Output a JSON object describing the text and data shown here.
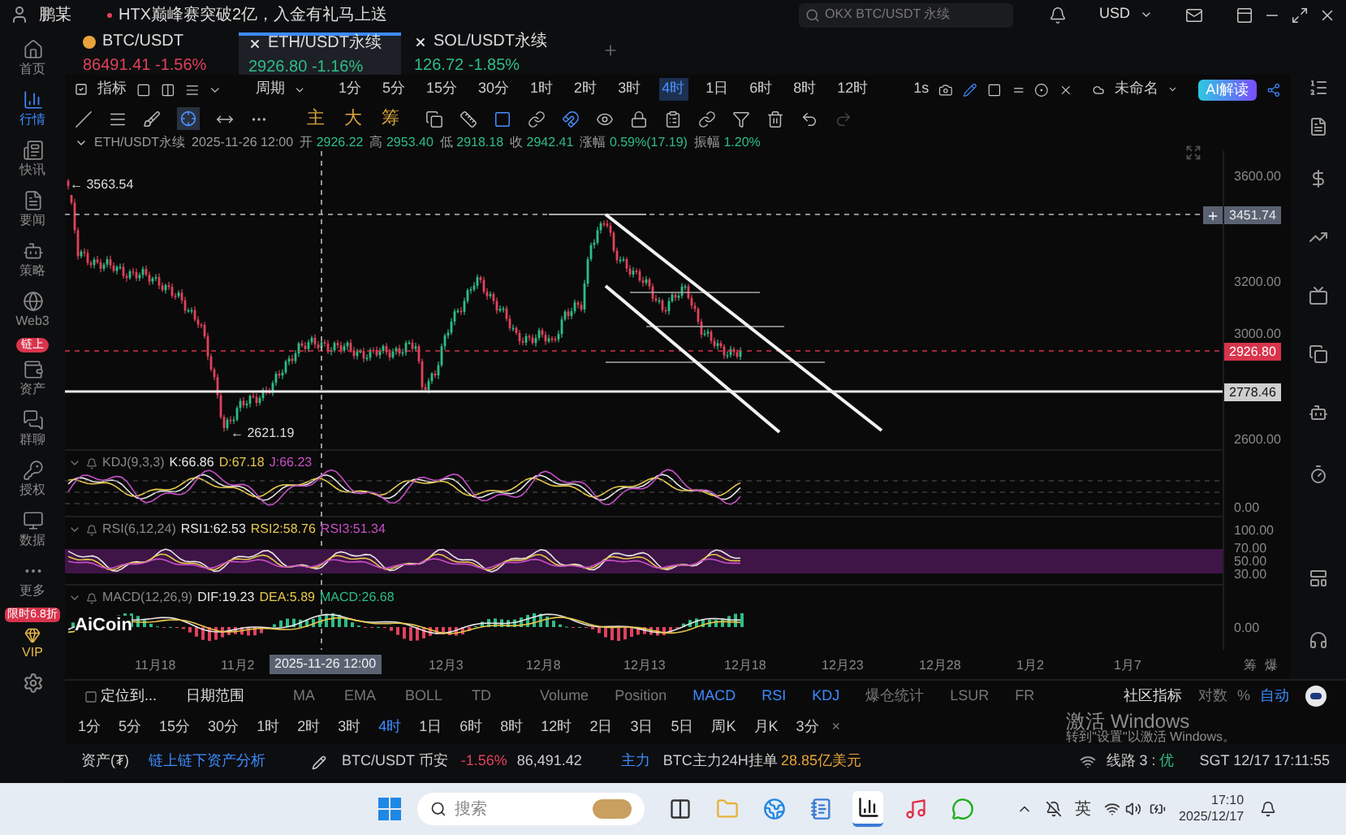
{
  "top_bar": {
    "user": "鹏某",
    "news": "HTX巅峰赛突破2亿，入金有礼马上送",
    "search": {
      "placeholder": "OKX BTC/USDT 永续"
    },
    "currency": "USD"
  },
  "sidebar": {
    "items": [
      {
        "label": "首页",
        "selected": false
      },
      {
        "label": "行情",
        "selected": true
      },
      {
        "label": "快讯",
        "selected": false
      },
      {
        "label": "要闻",
        "selected": false
      },
      {
        "label": "策略",
        "selected": false
      },
      {
        "label": "Web3",
        "selected": false
      },
      {
        "label": "资产",
        "selected": false
      },
      {
        "label": "群聊",
        "selected": false
      },
      {
        "label": "授权",
        "selected": false
      },
      {
        "label": "数据",
        "selected": false
      },
      {
        "label": "更多",
        "selected": false
      }
    ],
    "badge": "链上",
    "promo": "限时6.8折",
    "vip": "VIP"
  },
  "tabs": [
    {
      "symbol": "BTC/USDT",
      "price": "86491.41",
      "change": "-1.56%",
      "color": "#e0425b",
      "selected": false
    },
    {
      "symbol": "ETH/USDT永续",
      "price": "2926.80",
      "change": "-1.16%",
      "color": "#2ebd85",
      "selected": true
    },
    {
      "symbol": "SOL/USDT永续",
      "price": "126.72",
      "change": "-1.85%",
      "color": "#2ebd85",
      "selected": false
    }
  ],
  "toolbar": {
    "indicator": "指标",
    "period": "周期",
    "intervals": [
      {
        "label": "1分",
        "selected": false
      },
      {
        "label": "5分",
        "selected": false
      },
      {
        "label": "15分",
        "selected": false
      },
      {
        "label": "30分",
        "selected": false
      },
      {
        "label": "1时",
        "selected": false
      },
      {
        "label": "2时",
        "selected": false
      },
      {
        "label": "3时",
        "selected": false
      },
      {
        "label": "4时",
        "selected": true
      },
      {
        "label": "1日",
        "selected": false
      },
      {
        "label": "6时",
        "selected": false
      },
      {
        "label": "8时",
        "selected": false
      },
      {
        "label": "12时",
        "selected": false
      }
    ],
    "seconds": "1s",
    "layout": "未命名",
    "ai": "AI解读"
  },
  "drawing_tools": {
    "chips": [
      "主",
      "大",
      "筹"
    ]
  },
  "ohlc": {
    "symbol": "ETH/USDT永续",
    "time": "2025-11-26 12:00",
    "fields": [
      {
        "label": "开",
        "value": "2926.22"
      },
      {
        "label": "高",
        "value": "2953.40"
      },
      {
        "label": "低",
        "value": "2918.18"
      },
      {
        "label": "收",
        "value": "2942.41"
      },
      {
        "label": "涨幅",
        "value": "0.59%(17.19)"
      },
      {
        "label": "振幅",
        "value": "1.20%"
      }
    ]
  },
  "chart": {
    "price_axis": [
      "3600.00",
      "3200.00",
      "3000.00",
      "2600.00"
    ],
    "price_tags": [
      {
        "value": "3451.74",
        "kind": "cursor"
      },
      {
        "value": "2926.80",
        "kind": "last"
      },
      {
        "value": "2778.46",
        "kind": "line"
      }
    ],
    "high_mark": "← 3563.54",
    "low_mark": "← 2621.19",
    "watermark": "AiCoin",
    "dates": [
      "11月18",
      "11月2",
      "12月3",
      "12月8",
      "12月13",
      "12月18",
      "12月23",
      "12月28",
      "1月2",
      "1月7"
    ],
    "crosshair_time": "2025-11-26 12:00",
    "axis_end": [
      "筹",
      "爆"
    ]
  },
  "indicators": [
    {
      "name": "KDJ(9,3,3)",
      "values": [
        {
          "text": "K:66.86",
          "color": "#e6e6e6"
        },
        {
          "text": "D:67.18",
          "color": "#e6c84a"
        },
        {
          "text": "J:66.23",
          "color": "#c84fc8"
        }
      ],
      "axis": [
        "0.00"
      ]
    },
    {
      "name": "RSI(6,12,24)",
      "values": [
        {
          "text": "RSI1:62.53",
          "color": "#e6e6e6"
        },
        {
          "text": "RSI2:58.76",
          "color": "#e6c84a"
        },
        {
          "text": "RSI3:51.34",
          "color": "#c84fc8"
        }
      ],
      "axis": [
        "100.00",
        "70.00",
        "50.00",
        "30.00"
      ]
    },
    {
      "name": "MACD(12,26,9)",
      "values": [
        {
          "text": "DIF:19.23",
          "color": "#e6e6e6"
        },
        {
          "text": "DEA:5.89",
          "color": "#e6c84a"
        },
        {
          "text": "MACD:26.68",
          "color": "#2ebd85"
        }
      ],
      "axis": [
        "0.00"
      ]
    }
  ],
  "bottom_toolbar": {
    "locate": "定位到...",
    "date_range": "日期范围",
    "overlays": [
      "MA",
      "EMA",
      "BOLL",
      "TD"
    ],
    "panes": [
      {
        "label": "Volume",
        "active": false
      },
      {
        "label": "Position",
        "active": false
      },
      {
        "label": "MACD",
        "active": true
      },
      {
        "label": "RSI",
        "active": true
      },
      {
        "label": "KDJ",
        "active": true
      },
      {
        "label": "爆仓统计",
        "active": false
      },
      {
        "label": "LSUR",
        "active": false
      },
      {
        "label": "FR",
        "active": false
      }
    ],
    "community": "社区指标",
    "log": "对数",
    "percent": "%",
    "auto": {
      "label": "自动",
      "active": true
    }
  },
  "interval_bar": {
    "items": [
      {
        "label": "1分",
        "selected": false
      },
      {
        "label": "5分",
        "selected": false
      },
      {
        "label": "15分",
        "selected": false
      },
      {
        "label": "30分",
        "selected": false
      },
      {
        "label": "1时",
        "selected": false
      },
      {
        "label": "2时",
        "selected": false
      },
      {
        "label": "3时",
        "selected": false
      },
      {
        "label": "4时",
        "selected": true
      },
      {
        "label": "1日",
        "selected": false
      },
      {
        "label": "6时",
        "selected": false
      },
      {
        "label": "8时",
        "selected": false
      },
      {
        "label": "12时",
        "selected": false
      },
      {
        "label": "2日",
        "selected": false
      },
      {
        "label": "3日",
        "selected": false
      },
      {
        "label": "5日",
        "selected": false
      },
      {
        "label": "周K",
        "selected": false
      },
      {
        "label": "月K",
        "selected": false
      },
      {
        "label": "3分",
        "selected": false
      }
    ],
    "close": "×"
  },
  "activation": {
    "title": "激活 Windows",
    "subtitle": "转到\"设置\"以激活 Windows。"
  },
  "status_bar": {
    "assets": "资产(₮)",
    "asset_link": "链上链下资产分析",
    "pair": "BTC/USDT 币安",
    "change": "-1.56%",
    "price": "86,491.42",
    "tag": "主力",
    "headline": "BTC主力24H挂单",
    "amount": "28.85亿美元",
    "line": "线路 3 :",
    "quality": "优",
    "clock": "SGT 12/17 17:11:55"
  },
  "taskbar": {
    "search": {
      "placeholder": "搜索"
    },
    "apps": [
      {
        "kind": "taskview",
        "selected": false
      },
      {
        "kind": "folder",
        "selected": false
      },
      {
        "kind": "edge",
        "selected": false
      },
      {
        "kind": "notepad",
        "selected": false
      },
      {
        "kind": "aicoin",
        "selected": true
      },
      {
        "kind": "music",
        "selected": false
      },
      {
        "kind": "chat",
        "selected": false
      }
    ],
    "ime": "英",
    "time": "17:10",
    "date": "2025/12/17"
  }
}
